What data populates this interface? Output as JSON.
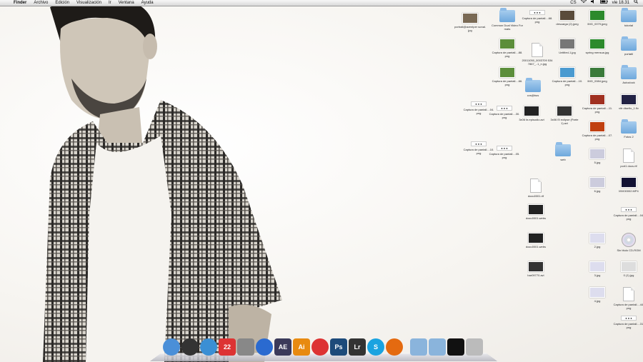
{
  "menubar": {
    "apple_glyph": "",
    "items": [
      "Finder",
      "Archivo",
      "Edición",
      "Visualización",
      "Ir",
      "Ventana",
      "Ayuda"
    ],
    "status": {
      "badge": "CS",
      "clock": "vie 18.31"
    }
  },
  "desktop_icons": [
    {
      "name": "person-photo",
      "label": "portrait@aventper sonal.jpg",
      "kind": "photo",
      "color": "#7a6a55"
    },
    {
      "name": "folder-common",
      "label": "Common Dual Video Formats",
      "kind": "folder"
    },
    {
      "name": "capture-1",
      "label": "Captura de pantall....68.png",
      "kind": "small"
    },
    {
      "name": "download-jpeg",
      "label": "descarga (2).jpeg",
      "kind": "photo",
      "color": "#5a4b3a"
    },
    {
      "name": "img-green",
      "label": "IMG_0079.jpeg",
      "kind": "photo",
      "color": "#2c8a2c"
    },
    {
      "name": "folder-tutorial",
      "label": "tutorial",
      "kind": "folder"
    },
    {
      "name": "capture-2",
      "label": "Captura de pantall....88.png",
      "kind": "photo",
      "color": "#5c8e3a"
    },
    {
      "name": "doc-2011",
      "label": "20011050_0003709 5347867_..1_n.jpg",
      "kind": "doc"
    },
    {
      "name": "untitled-jpg",
      "label": "Untitled-1.jpg",
      "kind": "photo",
      "color": "#777"
    },
    {
      "name": "spring-mem",
      "label": "spring mensua.jpg",
      "kind": "photo",
      "color": "#2c8a2c"
    },
    {
      "name": "folder-portatil",
      "label": "portatil",
      "kind": "folder"
    },
    {
      "name": "capture-3",
      "label": "Captura de pantall....66.png",
      "kind": "photo",
      "color": "#5c8e3a"
    },
    {
      "name": "capture-4",
      "label": "Captura de pantall....10.png",
      "kind": "photo",
      "color": "#4a9ad0"
    },
    {
      "name": "img-0084",
      "label": "IMG_0084.jpeg",
      "kind": "photo",
      "color": "#3a7a3a"
    },
    {
      "name": "folder-autoclock",
      "label": "Autoclock",
      "kind": "folder"
    },
    {
      "name": "folder-cvs",
      "label": "cvs@bus",
      "kind": "folder"
    },
    {
      "name": "capture-5",
      "label": "Captura de pantall....11.png",
      "kind": "photo",
      "color": "#a03020"
    },
    {
      "name": "img-vitro",
      "label": "vitr diseño_1.flv",
      "kind": "photo",
      "color": "#224"
    },
    {
      "name": "capture-6",
      "label": "Captura de pantall....04.png",
      "kind": "small"
    },
    {
      "name": "capture-7",
      "label": "Captura de pantall....30.png",
      "kind": "small"
    },
    {
      "name": "video-1",
      "label": "3x06 fa episodio.avi",
      "kind": "photo",
      "color": "#222"
    },
    {
      "name": "video-2",
      "label": "3x06 El eclipse (Parte 1).avi",
      "kind": "photo",
      "color": "#333"
    },
    {
      "name": "capture-8",
      "label": "Captura de pantall....07.png",
      "kind": "photo",
      "color": "#c04010"
    },
    {
      "name": "folder-fotos2",
      "label": "Fotos 2",
      "kind": "folder"
    },
    {
      "name": "capture-9",
      "label": "Captura de pantall....10.png",
      "kind": "small"
    },
    {
      "name": "capture-10",
      "label": "Captura de pantall....05.png",
      "kind": "small"
    },
    {
      "name": "folder-web",
      "label": "web",
      "kind": "folder"
    },
    {
      "name": "img-5jpg",
      "label": "5.jpg",
      "kind": "photo",
      "color": "#ccd"
    },
    {
      "name": "doc-port",
      "label": "port1 docs.rtf",
      "kind": "doc"
    },
    {
      "name": "doc-001",
      "label": "docu0001.rtf",
      "kind": "doc"
    },
    {
      "name": "img-6jpg",
      "label": "6.jpg",
      "kind": "photo",
      "color": "#ccd"
    },
    {
      "name": "video-mp4",
      "label": "MVI00002.MP4",
      "kind": "photo",
      "color": "#113"
    },
    {
      "name": "screen-1",
      "label": "docu0001.webs",
      "kind": "photo",
      "color": "#222"
    },
    {
      "name": "capture-11",
      "label": "Captura de pantall....04.png",
      "kind": "small"
    },
    {
      "name": "screen-2",
      "label": "docu0001.webs",
      "kind": "photo",
      "color": "#222"
    },
    {
      "name": "img-2jpg",
      "label": "2.jpg",
      "kind": "photo",
      "color": "#dde"
    },
    {
      "name": "disc-cd",
      "label": "Sin título CD-ROM",
      "kind": "disc"
    },
    {
      "name": "screen-3",
      "label": "bar09770.avi",
      "kind": "photo",
      "color": "#333"
    },
    {
      "name": "img-3jpg",
      "label": "3.jpg",
      "kind": "photo",
      "color": "#dde"
    },
    {
      "name": "img-0",
      "label": "0 (1).jpg",
      "kind": "photo",
      "color": "#ddd"
    },
    {
      "name": "img-4jpg",
      "label": "4.jpg",
      "kind": "photo",
      "color": "#dde"
    },
    {
      "name": "capture-12",
      "label": "Captura de pantall....44.png",
      "kind": "doc"
    },
    {
      "name": "capture-13",
      "label": "Captura de pantall....31.png",
      "kind": "small"
    }
  ],
  "dock": {
    "items": [
      {
        "name": "finder",
        "label": "",
        "color": "#4a8fd8"
      },
      {
        "name": "dashboard",
        "label": "",
        "color": "#333"
      },
      {
        "name": "safari",
        "label": "",
        "color": "#3b8fd4"
      },
      {
        "name": "ical",
        "label": "22",
        "color": "#d33"
      },
      {
        "name": "preview",
        "label": "",
        "color": "#888"
      },
      {
        "name": "itunes",
        "label": "",
        "color": "#2a6ad0"
      },
      {
        "name": "after-effects",
        "label": "AE",
        "color": "#3b3a5a"
      },
      {
        "name": "illustrator",
        "label": "Ai",
        "color": "#e88a10"
      },
      {
        "name": "chrome",
        "label": "",
        "color": "#d33"
      },
      {
        "name": "photoshop",
        "label": "Ps",
        "color": "#1d4a7a"
      },
      {
        "name": "lightroom",
        "label": "Lr",
        "color": "#333"
      },
      {
        "name": "skype",
        "label": "S",
        "color": "#1aa3e0"
      },
      {
        "name": "firefox",
        "label": "",
        "color": "#e46a10"
      },
      {
        "name": "applications-stack",
        "label": "",
        "color": "#8ab4dc"
      },
      {
        "name": "documents-stack",
        "label": "",
        "color": "#8ab4dc"
      },
      {
        "name": "downloads-stack",
        "label": "",
        "color": "#111"
      },
      {
        "name": "trash",
        "label": "",
        "color": "#bbb"
      }
    ]
  }
}
